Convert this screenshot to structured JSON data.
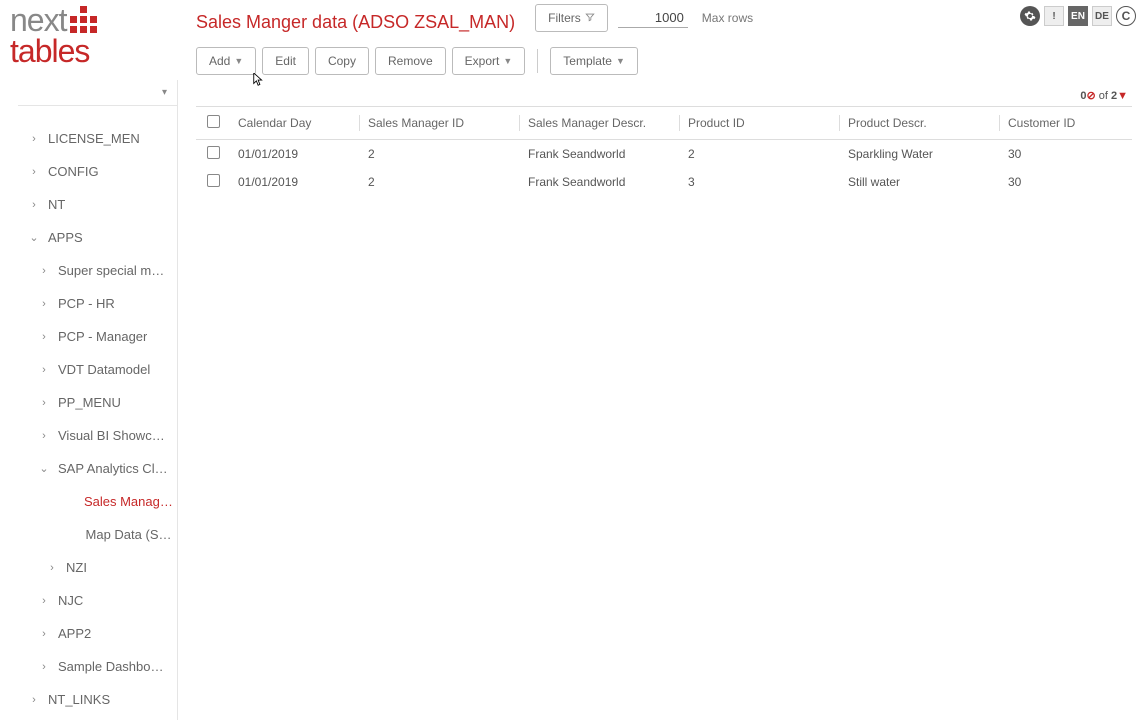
{
  "title": "Sales Manger data (ADSO ZSAL_MAN)",
  "toolbar": {
    "filters": "Filters",
    "add": "Add",
    "edit": "Edit",
    "copy": "Copy",
    "remove": "Remove",
    "export": "Export",
    "template": "Template"
  },
  "maxrows": {
    "value": "1000",
    "label": "Max rows"
  },
  "count": {
    "shown": "0",
    "of": "of",
    "total": "2"
  },
  "lang": {
    "en": "EN",
    "de": "DE",
    "info": "!",
    "copyright": "C"
  },
  "sidebar": {
    "items": [
      {
        "label": "LICENSE_MEN",
        "lvl": "lvl0",
        "chev": "›"
      },
      {
        "label": "CONFIG",
        "lvl": "lvl0",
        "chev": "›"
      },
      {
        "label": "NT",
        "lvl": "lvl0",
        "chev": "›"
      },
      {
        "label": "APPS",
        "lvl": "lvl0",
        "chev": "⌄",
        "open": true
      },
      {
        "label": "Super special mega ...",
        "lvl": "lvl1",
        "chev": "›"
      },
      {
        "label": "PCP - HR",
        "lvl": "lvl1",
        "chev": "›"
      },
      {
        "label": "PCP - Manager",
        "lvl": "lvl1",
        "chev": "›"
      },
      {
        "label": "VDT Datamodel",
        "lvl": "lvl1",
        "chev": "›"
      },
      {
        "label": "PP_MENU",
        "lvl": "lvl1",
        "chev": "›"
      },
      {
        "label": "Visual BI Showcase",
        "lvl": "lvl1",
        "chev": "›"
      },
      {
        "label": "SAP Analytics Cloud...",
        "lvl": "lvl1",
        "chev": "⌄",
        "open": true
      },
      {
        "label": "Sales Manager G...",
        "lvl": "lvl2",
        "chev": "",
        "active": true
      },
      {
        "label": "Map Data (SAC)",
        "lvl": "lvl2",
        "chev": ""
      },
      {
        "label": "NZI",
        "lvl": "lvl2b",
        "chev": "›"
      },
      {
        "label": "NJC",
        "lvl": "lvl1",
        "chev": "›"
      },
      {
        "label": "APP2",
        "lvl": "lvl1",
        "chev": "›"
      },
      {
        "label": "Sample Dashboard",
        "lvl": "lvl1",
        "chev": "›"
      },
      {
        "label": "NT_LINKS",
        "lvl": "lvl0",
        "chev": "›"
      }
    ]
  },
  "table": {
    "columns": [
      "Calendar Day",
      "Sales Manager ID",
      "Sales Manager Descr.",
      "Product ID",
      "Product Descr.",
      "Customer ID"
    ],
    "rows": [
      {
        "c0": "01/01/2019",
        "c1": "2",
        "c2": "Frank Seandworld",
        "c3": "2",
        "c4": "Sparkling Water",
        "c5": "30"
      },
      {
        "c0": "01/01/2019",
        "c1": "2",
        "c2": "Frank Seandworld",
        "c3": "3",
        "c4": "Still water",
        "c5": "30"
      }
    ]
  }
}
